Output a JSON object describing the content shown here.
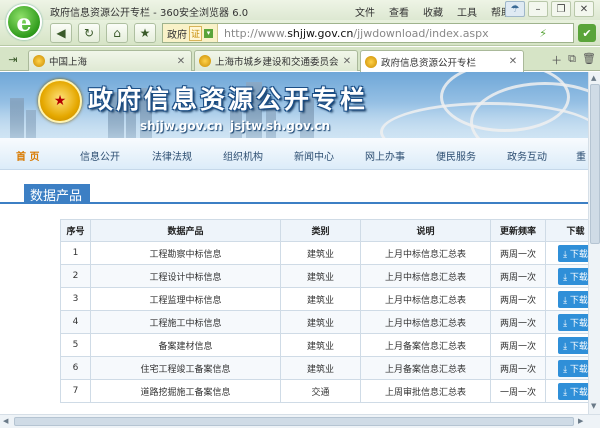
{
  "browser": {
    "window_title": "政府信息资源公开专栏 - 360安全浏览器 6.0",
    "logo_letter": "e",
    "menu": [
      "文件",
      "查看",
      "收藏",
      "工具",
      "帮助"
    ],
    "address_prefix": "政府",
    "cert_label": "证",
    "url_prefix": "http://www.",
    "url_domain": "shjjw.gov.cn",
    "url_path": "/jjwdownload/index.aspx",
    "tabs": [
      {
        "label": "中国上海"
      },
      {
        "label": "上海市城乡建设和交通委员会"
      },
      {
        "label": "政府信息资源公开专栏"
      }
    ]
  },
  "page": {
    "banner_title": "政府信息资源公开专栏",
    "banner_site1": "shjjw.gov.cn",
    "banner_site2": "jsjtw.sh.gov.cn",
    "nav": [
      "首 页",
      "信息公开",
      "法律法规",
      "组织机构",
      "新闻中心",
      "网上办事",
      "便民服务",
      "政务互动",
      "重"
    ],
    "section_title": "数据产品",
    "table": {
      "headers": [
        "序号",
        "数据产品",
        "类别",
        "说明",
        "更新频率",
        "下载"
      ],
      "download_label": "下载",
      "rows": [
        {
          "no": "1",
          "name": "工程勘察中标信息",
          "cat": "建筑业",
          "desc": "上月中标信息汇总表",
          "freq": "两周一次"
        },
        {
          "no": "2",
          "name": "工程设计中标信息",
          "cat": "建筑业",
          "desc": "上月中标信息汇总表",
          "freq": "两周一次"
        },
        {
          "no": "3",
          "name": "工程监理中标信息",
          "cat": "建筑业",
          "desc": "上月中标信息汇总表",
          "freq": "两周一次"
        },
        {
          "no": "4",
          "name": "工程施工中标信息",
          "cat": "建筑业",
          "desc": "上月中标信息汇总表",
          "freq": "两周一次"
        },
        {
          "no": "5",
          "name": "备案建材信息",
          "cat": "建筑业",
          "desc": "上月备案信息汇总表",
          "freq": "两周一次"
        },
        {
          "no": "6",
          "name": "住宅工程竣工备案信息",
          "cat": "建筑业",
          "desc": "上月备案信息汇总表",
          "freq": "两周一次"
        },
        {
          "no": "7",
          "name": "道路挖掘施工备案信息",
          "cat": "交通",
          "desc": "上周审批信息汇总表",
          "freq": "一周一次"
        }
      ]
    }
  },
  "colors": {
    "nav_home": "#d97a00",
    "section_blue": "#3c7fc4",
    "download_btn": "#2f8fd8",
    "browser_green": "#5aa43a"
  }
}
